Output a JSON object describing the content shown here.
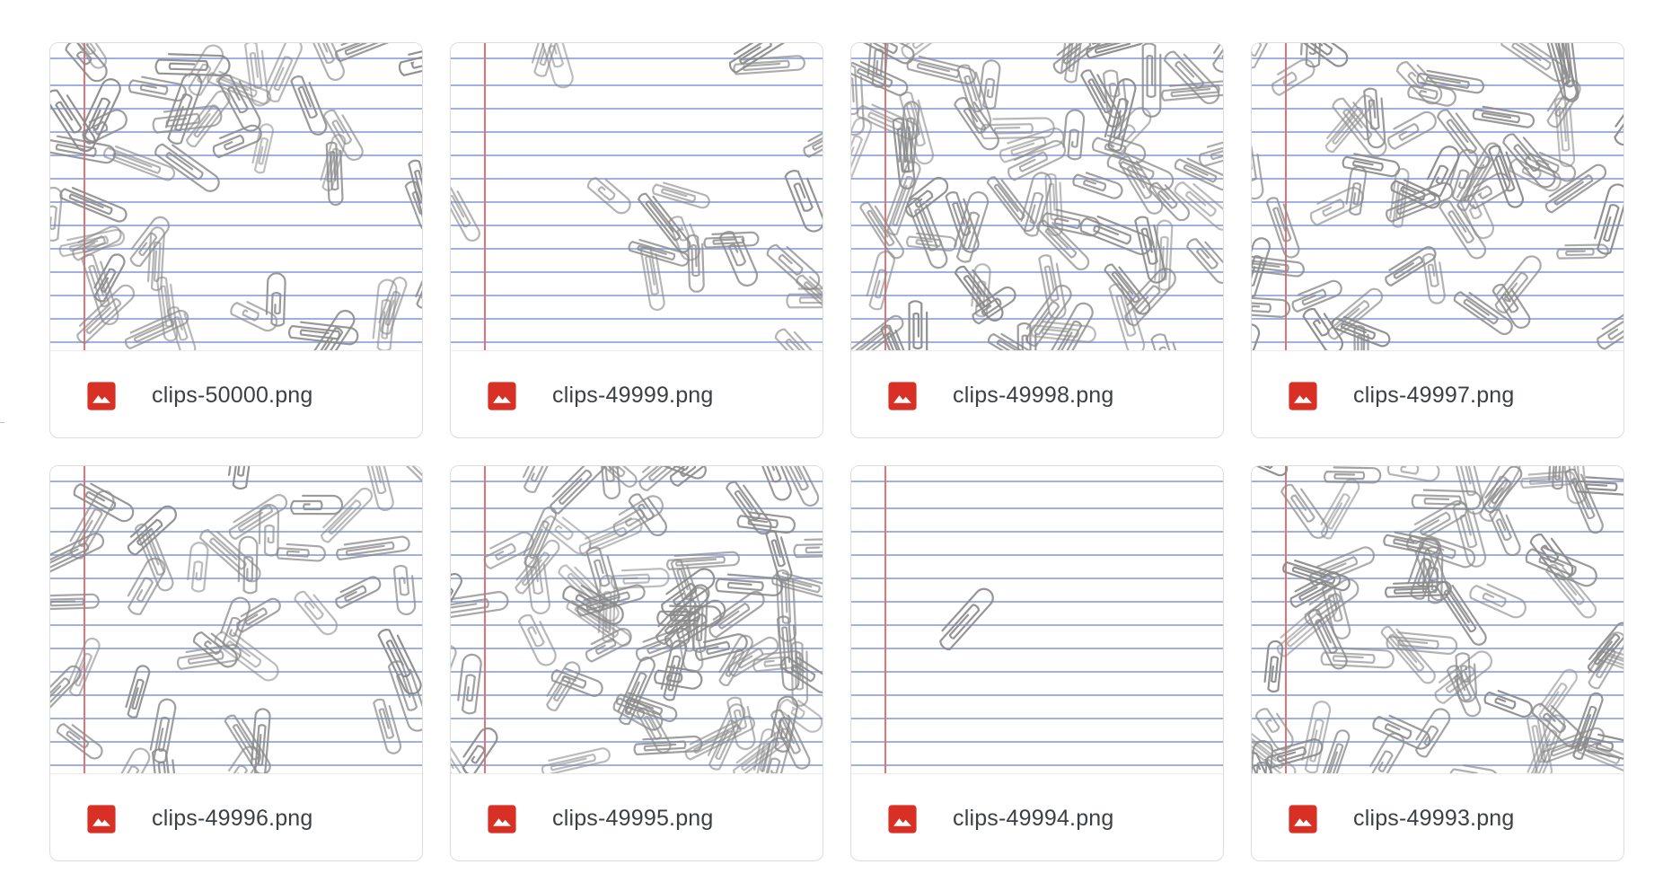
{
  "files": [
    {
      "name": "clips-50000.png",
      "file_type_icon": "image-file-icon",
      "clip_count": 48
    },
    {
      "name": "clips-49999.png",
      "file_type_icon": "image-file-icon",
      "clip_count": 20
    },
    {
      "name": "clips-49998.png",
      "file_type_icon": "image-file-icon",
      "clip_count": 70
    },
    {
      "name": "clips-49997.png",
      "file_type_icon": "image-file-icon",
      "clip_count": 55
    },
    {
      "name": "clips-49996.png",
      "file_type_icon": "image-file-icon",
      "clip_count": 40
    },
    {
      "name": "clips-49995.png",
      "file_type_icon": "image-file-icon",
      "clip_count": 75
    },
    {
      "name": "clips-49994.png",
      "file_type_icon": "image-file-icon",
      "clip_count": 1
    },
    {
      "name": "clips-49993.png",
      "file_type_icon": "image-file-icon",
      "clip_count": 65
    }
  ],
  "colors": {
    "file_icon": "#d93025",
    "margin_line": "#e57373",
    "ruled_line": "#9fb0e6",
    "clip_stroke": "#8a8a8a",
    "card_border": "#dadce0",
    "file_name_text": "#3c4043"
  }
}
